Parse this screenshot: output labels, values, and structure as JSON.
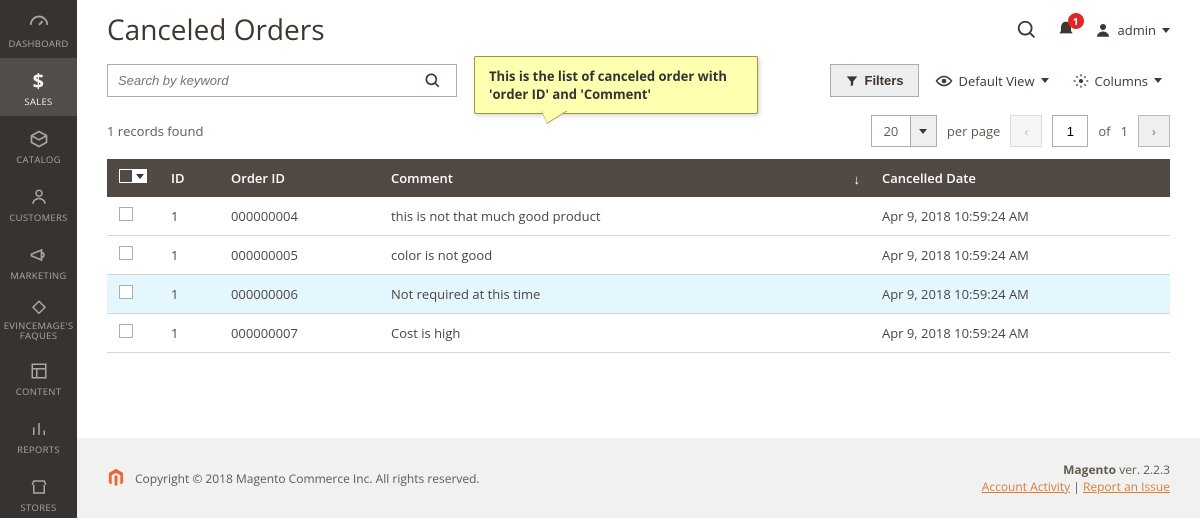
{
  "page_title": "Canceled Orders",
  "sidebar": [
    {
      "name": "dashboard",
      "label": "DASHBOARD"
    },
    {
      "name": "sales",
      "label": "SALES"
    },
    {
      "name": "catalog",
      "label": "CATALOG"
    },
    {
      "name": "customers",
      "label": "CUSTOMERS"
    },
    {
      "name": "marketing",
      "label": "MARKETING"
    },
    {
      "name": "evincemage",
      "label": "EVINCEMAGE'S FAQUES"
    },
    {
      "name": "content",
      "label": "CONTENT"
    },
    {
      "name": "reports",
      "label": "REPORTS"
    },
    {
      "name": "stores",
      "label": "STORES"
    }
  ],
  "notification_count": "1",
  "user_label": "admin",
  "search_placeholder": "Search by keyword",
  "callout_text": "This is the list of canceled order with 'order ID' and 'Comment'",
  "filters_label": "Filters",
  "default_view_label": "Default View",
  "columns_label": "Columns",
  "records_found_label": "1 records found",
  "page_size": "20",
  "per_page_label": "per page",
  "current_page": "1",
  "of_label": "of",
  "total_pages": "1",
  "columns_headers": {
    "id": "ID",
    "order_id": "Order ID",
    "comment": "Comment",
    "cancelled_date": "Cancelled Date"
  },
  "rows": [
    {
      "id": "1",
      "order_id": "000000004",
      "comment": "this is not that much good product",
      "cancelled_date": "Apr 9, 2018 10:59:24 AM"
    },
    {
      "id": "1",
      "order_id": "000000005",
      "comment": "color is not good",
      "cancelled_date": "Apr 9, 2018 10:59:24 AM"
    },
    {
      "id": "1",
      "order_id": "000000006",
      "comment": "Not required at this time",
      "cancelled_date": "Apr 9, 2018 10:59:24 AM"
    },
    {
      "id": "1",
      "order_id": "000000007",
      "comment": "Cost is high",
      "cancelled_date": "Apr 9, 2018 10:59:24 AM"
    }
  ],
  "footer_copyright": "Copyright © 2018 Magento Commerce Inc. All rights reserved.",
  "footer_brand": "Magento",
  "footer_version": " ver. 2.2.3",
  "footer_activity": "Account Activity",
  "footer_report": "Report an Issue"
}
